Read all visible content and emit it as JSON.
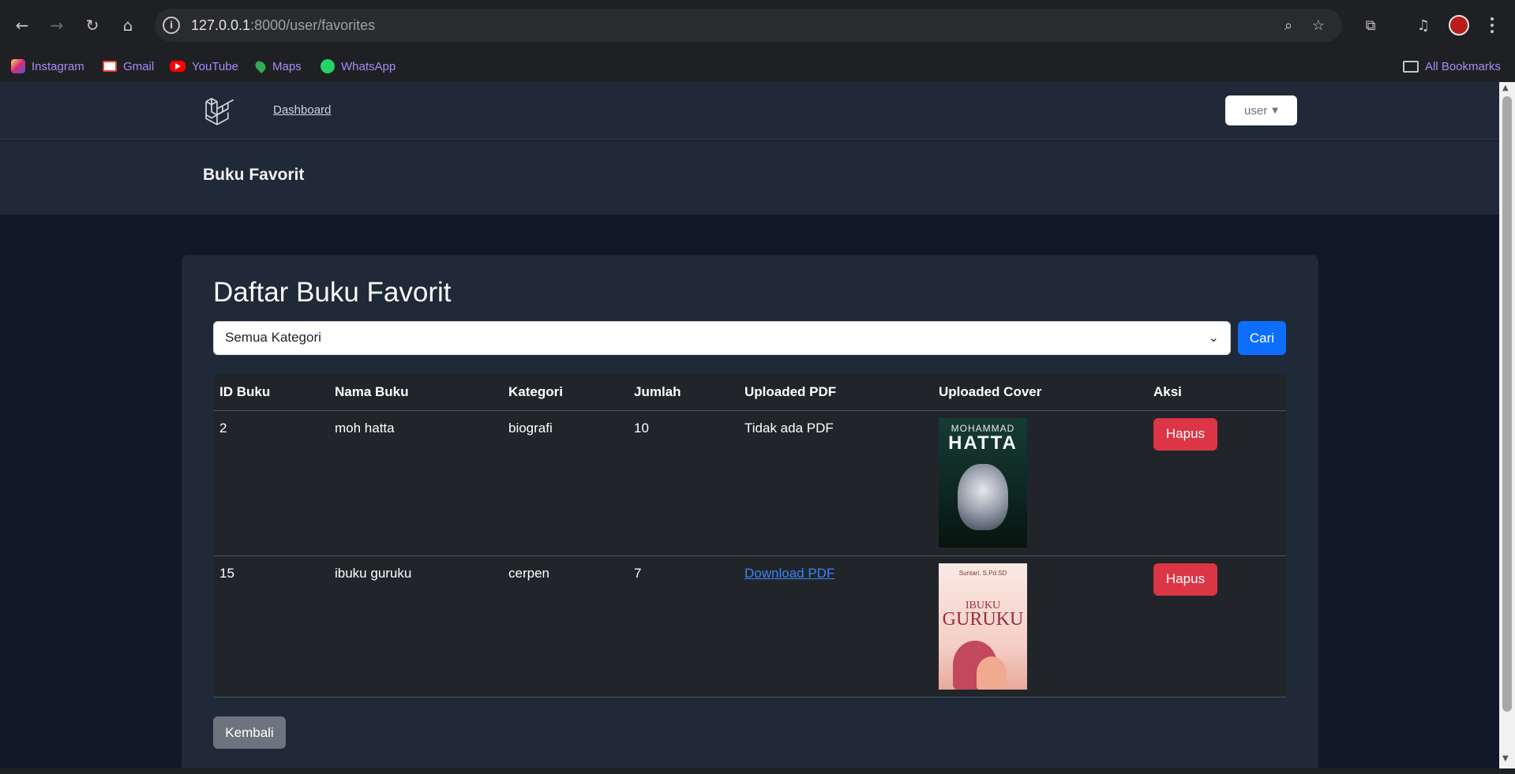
{
  "browser": {
    "url_host": "127.0.0.1",
    "url_rest": ":8000/user/favorites",
    "icons": [
      "back-icon",
      "forward-icon",
      "reload-icon",
      "home-icon",
      "site-info-icon",
      "zoom-icon",
      "bookmark-star-icon",
      "extensions-icon",
      "media-icon",
      "profile-avatar",
      "menu-icon"
    ]
  },
  "bookmarks": [
    {
      "label": "Instagram",
      "icon": "instagram-icon"
    },
    {
      "label": "Gmail",
      "icon": "gmail-icon"
    },
    {
      "label": "YouTube",
      "icon": "youtube-icon"
    },
    {
      "label": "Maps",
      "icon": "maps-icon"
    },
    {
      "label": "WhatsApp",
      "icon": "whatsapp-icon"
    }
  ],
  "all_bookmarks": "All Bookmarks",
  "nav": {
    "dashboard": "Dashboard",
    "user_menu": "user"
  },
  "header": {
    "title": "Buku Favorit"
  },
  "main": {
    "title": "Daftar Buku Favorit",
    "category_select": "Semua Kategori",
    "search_button": "Cari",
    "back_button": "Kembali",
    "table": {
      "headers": [
        "ID Buku",
        "Nama Buku",
        "Kategori",
        "Jumlah",
        "Uploaded PDF",
        "Uploaded Cover",
        "Aksi"
      ],
      "rows": [
        {
          "id": "2",
          "name": "moh hatta",
          "category": "biografi",
          "qty": "10",
          "pdf": "Tidak ada PDF",
          "pdf_is_link": false,
          "cover": {
            "line1": "MOHAMMAD",
            "line2": "HATTA"
          },
          "action": "Hapus"
        },
        {
          "id": "15",
          "name": "ibuku guruku",
          "category": "cerpen",
          "qty": "7",
          "pdf": "Download PDF",
          "pdf_is_link": true,
          "cover": {
            "author": "Suntari. S.Pd.SD",
            "line1": "IBUKU",
            "line2": "GURUKU"
          },
          "action": "Hapus"
        }
      ]
    }
  },
  "colors": {
    "page_bg": "#111827",
    "card_bg": "#1f2937",
    "primary": "#0d6efd",
    "danger": "#dc3545",
    "secondary": "#6c757d",
    "link": "#3b82f6"
  }
}
